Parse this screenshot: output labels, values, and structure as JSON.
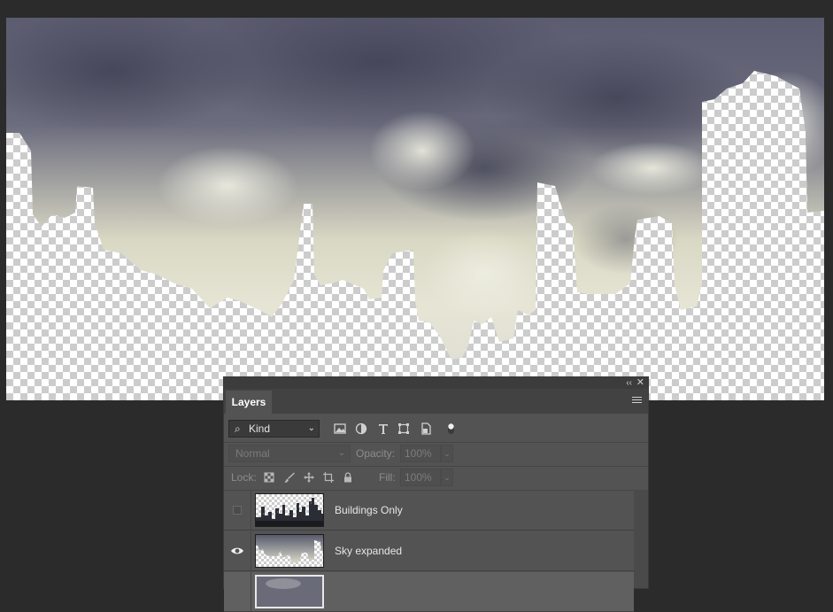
{
  "panel": {
    "tab_label": "Layers",
    "collapse_glyph": "‹‹",
    "close_glyph": "✕",
    "menu_icon": "panel-menu-icon"
  },
  "filter": {
    "search_glyph": "⌕",
    "kind_label": "Kind",
    "icons": [
      "pixel-layer-filter-icon",
      "adjustment-layer-filter-icon",
      "type-layer-filter-icon",
      "shape-layer-filter-icon",
      "smart-object-filter-icon",
      "filter-toggle-icon"
    ]
  },
  "blend": {
    "mode": "Normal",
    "opacity_label": "Opacity:",
    "opacity_value": "100%"
  },
  "lock": {
    "label": "Lock:",
    "icons": [
      "lock-transparent-pixels-icon",
      "lock-image-pixels-icon",
      "lock-position-icon",
      "lock-artboard-icon",
      "lock-all-icon"
    ],
    "fill_label": "Fill:",
    "fill_value": "100%"
  },
  "layers": [
    {
      "name": "Buildings Only",
      "visible": false,
      "thumb": "buildings"
    },
    {
      "name": "Sky expanded",
      "visible": true,
      "thumb": "sky"
    },
    {
      "name": "",
      "visible": false,
      "thumb": "sky",
      "selected": true
    }
  ],
  "colors": {
    "app_background": "#2b2b2b",
    "panel_background": "#535353",
    "transparency_checker": "#cccccc",
    "storm_cloud": "#4f5065",
    "pale_cloud": "#e4e2cc"
  }
}
